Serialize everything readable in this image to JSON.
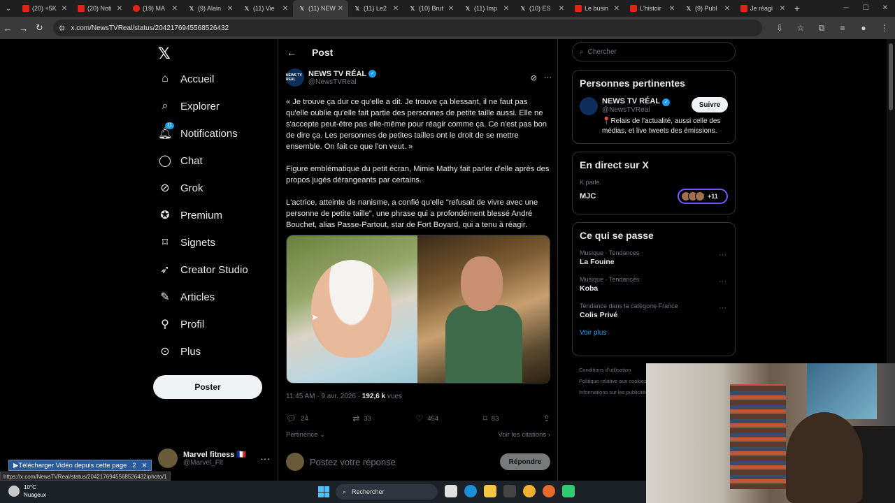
{
  "browser": {
    "tabs": [
      {
        "label": "(20) +5K",
        "kind": "yt"
      },
      {
        "label": "(20) Noti",
        "kind": "yt"
      },
      {
        "label": "(19) MA",
        "kind": "ph"
      },
      {
        "label": "(9) Alain",
        "kind": "x"
      },
      {
        "label": "(11) Vie",
        "kind": "x"
      },
      {
        "label": "(11) NEW",
        "kind": "x",
        "active": true
      },
      {
        "label": "(11) Le2",
        "kind": "x"
      },
      {
        "label": "(10) Brut",
        "kind": "x"
      },
      {
        "label": "(11) Imp",
        "kind": "x"
      },
      {
        "label": "(10) ES",
        "kind": "x"
      },
      {
        "label": "Le busin",
        "kind": "yt"
      },
      {
        "label": "L'histoir",
        "kind": "yt"
      },
      {
        "label": "(9) Publ",
        "kind": "x"
      },
      {
        "label": "Je réagi",
        "kind": "yt"
      }
    ],
    "url": "x.com/NewsTVReal/status/2042176945568526432",
    "status_url": "https://x.com/NewsTVReal/status/2042176945568526432/photo/1",
    "download_banner": "Télécharger Vidéo depuis cette page",
    "download_count": "2"
  },
  "nav": {
    "items": [
      {
        "label": "Accueil",
        "icon": "home-icon"
      },
      {
        "label": "Explorer",
        "icon": "search-icon"
      },
      {
        "label": "Notifications",
        "icon": "bell-icon"
      },
      {
        "label": "Chat",
        "icon": "chat-icon"
      },
      {
        "label": "Grok",
        "icon": "grok-icon"
      },
      {
        "label": "Premium",
        "icon": "premium-icon"
      },
      {
        "label": "Signets",
        "icon": "bookmark-icon"
      },
      {
        "label": "Creator Studio",
        "icon": "rocket-icon"
      },
      {
        "label": "Articles",
        "icon": "article-icon"
      },
      {
        "label": "Profil",
        "icon": "person-icon"
      },
      {
        "label": "Plus",
        "icon": "more-icon"
      }
    ],
    "notif_badge": "11",
    "post_button": "Poster",
    "account": {
      "name": "Marvel fitness 🇫🇷",
      "handle": "@Marvel_Flt"
    }
  },
  "post": {
    "header": "Post",
    "author_name": "NEWS TV RÉAL",
    "author_handle": "@NewsTVReal",
    "avatar_text": "NEWS TV REAL",
    "paragraphs": [
      "« Je trouve ça dur ce qu'elle a dit. Je trouve ça blessant, il ne faut pas qu'elle oublie qu'elle fait partie des personnes de petite taille aussi. Elle ne s'accepte peut-être pas elle-même pour réagir comme ça. Ce n'est pas bon de dire ça. Les personnes de petites tailles ont le droit de se mettre ensemble. On fait ce que l'on veut. »",
      "Figure emblématique du petit écran, Mimie Mathy fait parler d'elle après des propos jugés dérangeants par certains.",
      "L'actrice, atteinte de nanisme, a confié qu'elle \"refusait de vivre avec une personne de petite taille\", une phrase qui a profondément blessé André Bouchet, alias Passe-Partout, star de Fort Boyard, qui a tenu à réagir."
    ],
    "time": "11:45 AM · 9 avr. 2026 · ",
    "views_count": "192,6 k",
    "views_label": " vues",
    "stats": {
      "replies": "24",
      "reposts": "33",
      "likes": "454",
      "bookmarks": "83"
    },
    "sort_label": "Pertinence",
    "quotes_label": "Voir les citations",
    "reply_placeholder": "Postez votre réponse",
    "reply_button": "Répondre"
  },
  "sidebar": {
    "search_placeholder": "Chercher",
    "relevant_title": "Personnes pertinentes",
    "relevant": {
      "name": "NEWS TV RÉAL",
      "handle": "@NewsTVReal",
      "follow": "Suivre",
      "bio": "📍Relais de l'actualité, aussi celle des médias, et live tweets des émissions."
    },
    "live_title": "En direct sur X",
    "live_sub": "K parle.",
    "live_name": "MJC",
    "live_count": "+11",
    "trends_title": "Ce qui se passe",
    "trends": [
      {
        "category": "Musique · Tendances",
        "name": "La Fouine"
      },
      {
        "category": "Musique · Tendances",
        "name": "Koba"
      },
      {
        "category": "Tendance dans la catégorie France",
        "name": "Colis Privé"
      }
    ],
    "see_more": "Voir plus",
    "footer": [
      "Conditions d'utilisation",
      "Politique relative aux cookies",
      "Informations sur les publicités"
    ]
  },
  "taskbar": {
    "temp": "10°C",
    "weather": "Nuageux",
    "search": "Rechercher"
  },
  "colors": {
    "accent": "#1d9bf0",
    "bg": "#000000",
    "muted": "#71767b"
  }
}
